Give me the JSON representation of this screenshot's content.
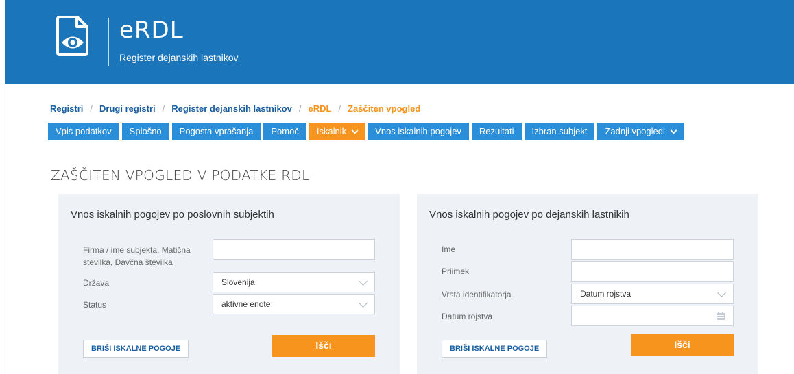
{
  "header": {
    "title": "eRDL",
    "subtitle": "Register dejanskih lastnikov"
  },
  "breadcrumb": [
    {
      "label": "Registri",
      "active": false
    },
    {
      "label": "Drugi registri",
      "active": false
    },
    {
      "label": "Register dejanskih lastnikov",
      "active": false
    },
    {
      "label": "eRDL",
      "active": true
    },
    {
      "label": "Zaščiten vpogled",
      "active": true
    }
  ],
  "nav": {
    "tab1": "Vpis podatkov",
    "tab2": "Splošno",
    "tab3": "Pogosta vprašanja",
    "tab4": "Pomoč",
    "tab5": "Iskalnik",
    "tab6": "Vnos iskalnih pogojev",
    "tab7": "Rezultati",
    "tab8": "Izbran subjekt",
    "tab9": "Zadnji vpogledi"
  },
  "page_title": "ZAŠČITEN VPOGLED V PODATKE RDL",
  "left_panel": {
    "title": "Vnos iskalnih pogojev po poslovnih subjektih",
    "company_label": "Firma / ime subjekta, Matična številka, Davčna številka",
    "company_value": "",
    "country_label": "Država",
    "country_value": "Slovenija",
    "status_label": "Status",
    "status_value": "aktivne enote",
    "clear_button": "BRIŠI ISKALNE POGOJE",
    "search_button": "Išči"
  },
  "right_panel": {
    "title": "Vnos iskalnih pogojev po dejanskih lastnikih",
    "name_label": "Ime",
    "name_value": "",
    "surname_label": "Priimek",
    "surname_value": "",
    "id_type_label": "Vrsta identifikatorja",
    "id_type_value": "Datum rojstva",
    "dob_label": "Datum rojstva",
    "dob_value": "",
    "clear_button": "BRIŠI ISKALNE POGOJE",
    "search_button": "Išči"
  },
  "colors": {
    "header_blue": "#1b75bb",
    "nav_blue": "#2b8ed8",
    "accent_orange": "#f7941d",
    "panel_bg": "#eef1f6"
  },
  "icons": {
    "logo": "document-eye-icon",
    "dropdown": "chevron-down-icon",
    "calendar": "calendar-icon"
  }
}
